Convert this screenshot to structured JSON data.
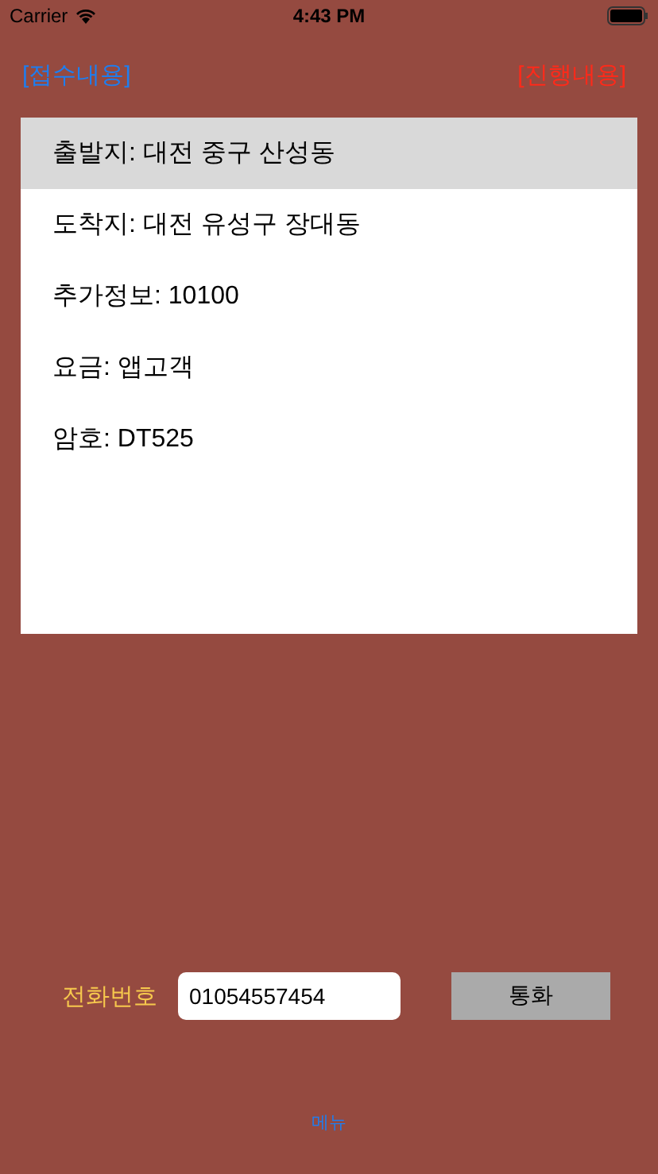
{
  "status_bar": {
    "carrier": "Carrier",
    "time": "4:43 PM"
  },
  "header": {
    "left": "[접수내용]",
    "right": "[진행내용]"
  },
  "list": [
    {
      "text": "출발지: 대전 중구 산성동",
      "selected": true
    },
    {
      "text": "도착지: 대전 유성구 장대동",
      "selected": false
    },
    {
      "text": "추가정보: 10100",
      "selected": false
    },
    {
      "text": "요금: 앱고객",
      "selected": false
    },
    {
      "text": "암호: DT525",
      "selected": false
    }
  ],
  "phone": {
    "label": "전화번호",
    "value": "01054557454",
    "button": "통화"
  },
  "menu": "메뉴"
}
